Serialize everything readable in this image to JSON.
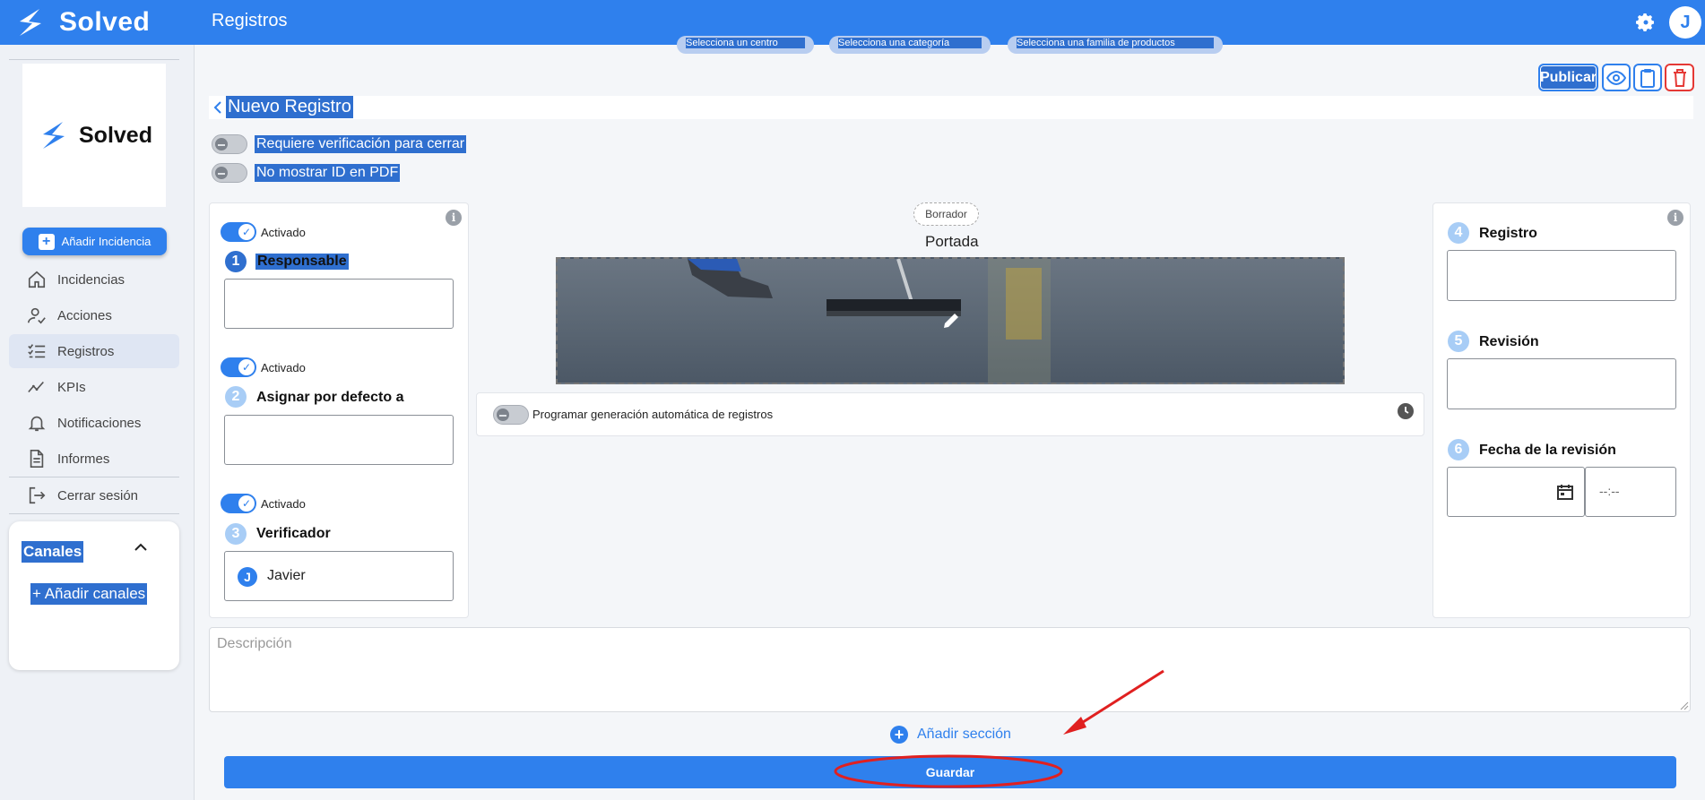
{
  "app": {
    "brand": "Solved",
    "page_heading": "Registros",
    "user_initial": "J"
  },
  "sidebar": {
    "logo_text": "Solved",
    "add_incident_label": "Añadir Incidencia",
    "items": [
      {
        "label": "Incidencias",
        "icon": "home-icon"
      },
      {
        "label": "Acciones",
        "icon": "user-check-icon"
      },
      {
        "label": "Registros",
        "icon": "checklist-icon",
        "active": true
      },
      {
        "label": "KPIs",
        "icon": "trend-icon"
      },
      {
        "label": "Notificaciones",
        "icon": "bell-icon"
      },
      {
        "label": "Informes",
        "icon": "document-icon"
      },
      {
        "label": "Cerrar sesión",
        "icon": "logout-icon"
      }
    ],
    "channels": {
      "title": "Canales",
      "add_label": "+ Añadir canales"
    }
  },
  "filters": [
    "Selecciona un centro",
    "Selecciona una categoría",
    "Selecciona una familia de productos"
  ],
  "toolbar": {
    "publish_label": "Publicar"
  },
  "form": {
    "title": "Nuevo Registro",
    "toggles": [
      {
        "label": "Requiere verificación para cerrar",
        "on": false
      },
      {
        "label": "No mostrar ID en PDF",
        "on": false
      }
    ],
    "left_steps": [
      {
        "num": "1",
        "title": "Responsable",
        "activated_label": "Activado",
        "value": ""
      },
      {
        "num": "2",
        "title": "Asignar por defecto a",
        "activated_label": "Activado",
        "value": ""
      },
      {
        "num": "3",
        "title": "Verificador",
        "activated_label": "Activado",
        "value": "Javier",
        "avatar_initial": "J"
      }
    ],
    "center": {
      "status_badge": "Borrador",
      "cover_label": "Portada",
      "schedule_label": "Programar generación automática de registros"
    },
    "right_steps": [
      {
        "num": "4",
        "title": "Registro"
      },
      {
        "num": "5",
        "title": "Revisión"
      },
      {
        "num": "6",
        "title": "Fecha de la revisión",
        "time_placeholder": "--:--"
      }
    ],
    "description_placeholder": "Descripción",
    "add_section_label": "Añadir sección",
    "save_label": "Guardar"
  },
  "colors": {
    "primary": "#2f80ed",
    "danger": "#e53935",
    "annotation": "#e02020"
  }
}
